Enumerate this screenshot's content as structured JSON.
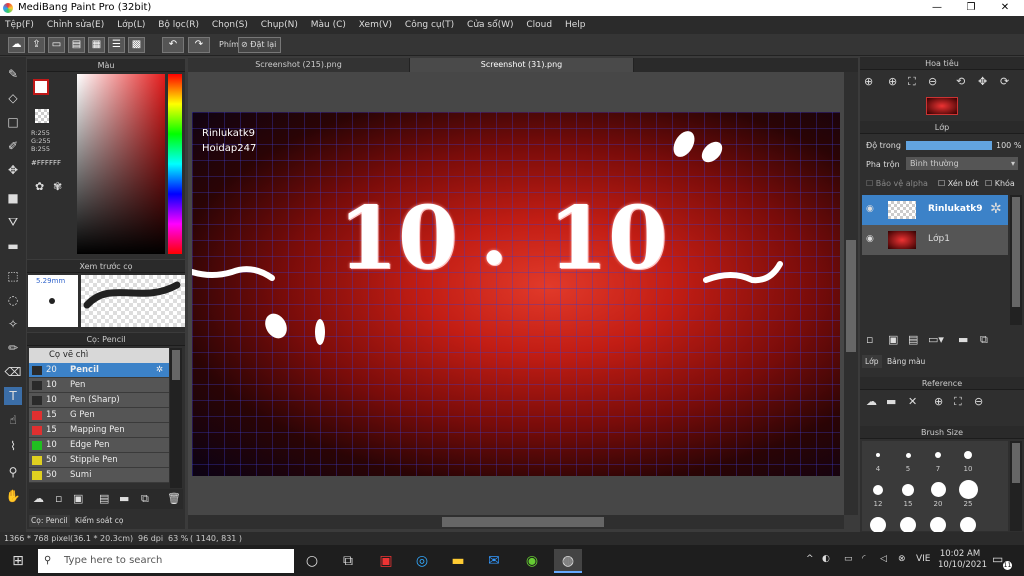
{
  "window": {
    "title": "MediBang Paint Pro (32bit)",
    "min": "—",
    "max": "❐",
    "close": "✕"
  },
  "menu": [
    "Tệp(F)",
    "Chỉnh sửa(E)",
    "Lớp(L)",
    "Bộ lọc(R)",
    "Chọn(S)",
    "Chụp(N)",
    "Màu (C)",
    "Xem(V)",
    "Công cụ(T)",
    "Cửa sổ(W)",
    "Cloud",
    "Help"
  ],
  "toolbar": {
    "key_label": "Phím",
    "reset_label": "Đặt lại"
  },
  "color_panel": {
    "title": "Màu",
    "r": "R:255",
    "g": "G:255",
    "b": "B:255",
    "hex": "#FFFFFF"
  },
  "preview_panel": {
    "title": "Xem trước cọ",
    "size": "5.29mm"
  },
  "brush_panel": {
    "title": "Cọ: Pencil",
    "group": "Cọ vẽ chì",
    "items": [
      {
        "size": "20",
        "name": "Pencil",
        "color": "#2a2a2a",
        "selected": true
      },
      {
        "size": "10",
        "name": "Pen",
        "color": "#2a2a2a"
      },
      {
        "size": "10",
        "name": "Pen (Sharp)",
        "color": "#2a2a2a"
      },
      {
        "size": "15",
        "name": "G Pen",
        "color": "#e03030"
      },
      {
        "size": "15",
        "name": "Mapping Pen",
        "color": "#e03030"
      },
      {
        "size": "10",
        "name": "Edge Pen",
        "color": "#20c020"
      },
      {
        "size": "50",
        "name": "Stipple Pen",
        "color": "#e0d020"
      },
      {
        "size": "50",
        "name": "Sumi",
        "color": "#e0d020"
      }
    ],
    "tab1": "Cọ: Pencil",
    "tab2": "Kiểm soát cọ"
  },
  "doc_tabs": [
    "Screenshot (215).png",
    "Screenshot (31).png"
  ],
  "artwork": {
    "line1": "Rinlukatk9",
    "line2": "Hoidap247",
    "big_left": "10",
    "dot": ".",
    "big_right": "10"
  },
  "navigator": {
    "title": "Hoa tiêu"
  },
  "layers": {
    "title": "Lớp",
    "opacity_label": "Độ trong",
    "opacity_value": "100 %",
    "blend_label": "Pha trộn",
    "blend_value": "Bình thường",
    "protect_alpha": "Bảo vệ alpha",
    "clip": "Xén bớt",
    "lock": "Khóa",
    "items": [
      {
        "name": "Rinlukatk9",
        "selected": true
      },
      {
        "name": "Lớp1",
        "selected": false
      }
    ],
    "tab1": "Lớp",
    "tab2": "Bảng màu"
  },
  "reference": {
    "title": "Reference"
  },
  "brush_size": {
    "title": "Brush Size",
    "sizes": [
      "4",
      "5",
      "7",
      "10",
      "12",
      "15",
      "20",
      "25"
    ]
  },
  "status": {
    "dims": "1366 * 768 pixel",
    "cm": "(36.1 * 20.3cm)",
    "dpi": "96 dpi",
    "zoom": "63 %",
    "coords": "( 1140, 831 )"
  },
  "taskbar": {
    "search_placeholder": "Type here to search",
    "time": "10:02 AM",
    "date": "10/10/2021",
    "lang": "VIE",
    "notif": "11"
  }
}
